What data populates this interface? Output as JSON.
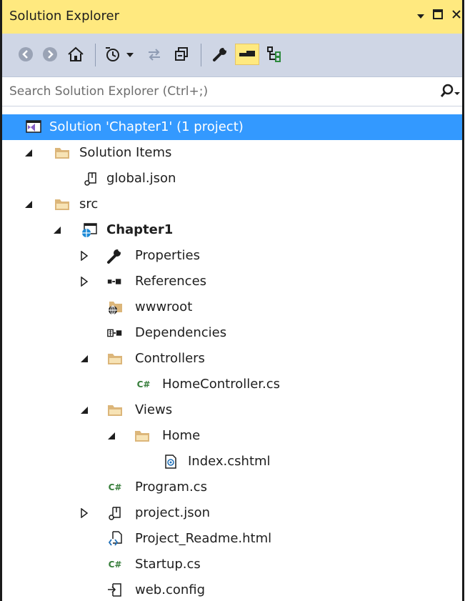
{
  "window": {
    "title": "Solution Explorer",
    "controls": [
      "dropdown-icon",
      "maximize-icon",
      "close-icon"
    ]
  },
  "toolbar": {
    "buttons": [
      "back-icon",
      "forward-icon",
      "home-icon",
      "pending-changes-icon",
      "sync-icon",
      "collapse-all-icon",
      "properties-wrench-icon",
      "preview-selected-icon",
      "view-switch-icon"
    ]
  },
  "search": {
    "placeholder": "Search Solution Explorer (Ctrl+;)"
  },
  "tree": {
    "items": [
      {
        "label": "Solution 'Chapter1' (1 project)",
        "icon": "solution-icon",
        "selected": true
      },
      {
        "label": "Solution Items",
        "icon": "folder-icon",
        "expanded": true
      },
      {
        "label": "global.json",
        "icon": "json-file-icon"
      },
      {
        "label": "src",
        "icon": "folder-icon",
        "expanded": true
      },
      {
        "label": "Chapter1",
        "icon": "web-project-icon",
        "expanded": true,
        "bold": true
      },
      {
        "label": "Properties",
        "icon": "wrench-icon",
        "expanded": false
      },
      {
        "label": "References",
        "icon": "references-icon",
        "expanded": false
      },
      {
        "label": "wwwroot",
        "icon": "globe-folder-icon"
      },
      {
        "label": "Dependencies",
        "icon": "dependencies-icon"
      },
      {
        "label": "Controllers",
        "icon": "folder-icon",
        "expanded": true
      },
      {
        "label": "HomeController.cs",
        "icon": "csharp-file-icon"
      },
      {
        "label": "Views",
        "icon": "folder-icon",
        "expanded": true
      },
      {
        "label": "Home",
        "icon": "folder-icon",
        "expanded": true
      },
      {
        "label": "Index.cshtml",
        "icon": "cshtml-file-icon"
      },
      {
        "label": "Program.cs",
        "icon": "csharp-file-icon"
      },
      {
        "label": "project.json",
        "icon": "json-file-icon",
        "expanded": false
      },
      {
        "label": "Project_Readme.html",
        "icon": "html-file-icon"
      },
      {
        "label": "Startup.cs",
        "icon": "csharp-file-icon"
      },
      {
        "label": "web.config",
        "icon": "config-file-icon"
      }
    ]
  },
  "colors": {
    "titlebar": "#ffe97f",
    "toolbar": "#cfd6e5",
    "selection": "#3399ff",
    "folder": "#dcb67a",
    "csharp": "#367d3a"
  }
}
